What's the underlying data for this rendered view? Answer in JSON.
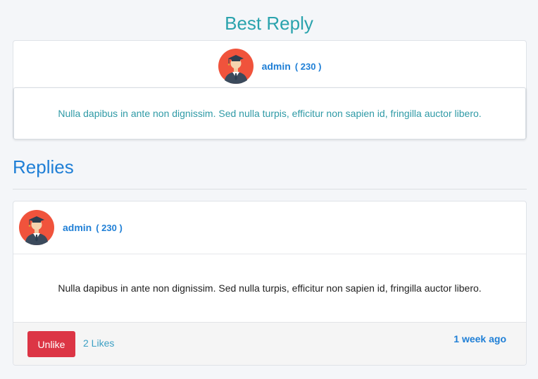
{
  "best_reply": {
    "title": "Best Reply",
    "author": {
      "name": "admin",
      "score": "( 230 )"
    },
    "text": "Nulla dapibus in ante non dignissim. Sed nulla turpis, efficitur non sapien id, fringilla auctor libero."
  },
  "replies": {
    "title": "Replies",
    "items": [
      {
        "author": {
          "name": "admin",
          "score": "( 230 )"
        },
        "text": "Nulla dapibus in ante non dignissim. Sed nulla turpis, efficitur non sapien id, fringilla auctor libero.",
        "unlike_label": "Unlike",
        "likes_label": "2 Likes",
        "time": "1 week ago"
      }
    ]
  },
  "icons": {
    "avatar": "graduate-avatar-icon"
  },
  "colors": {
    "best_title": "#2aa3ad",
    "accent_blue": "#1f7fd6",
    "danger": "#dc3545",
    "avatar_bg": "#f0533c"
  }
}
